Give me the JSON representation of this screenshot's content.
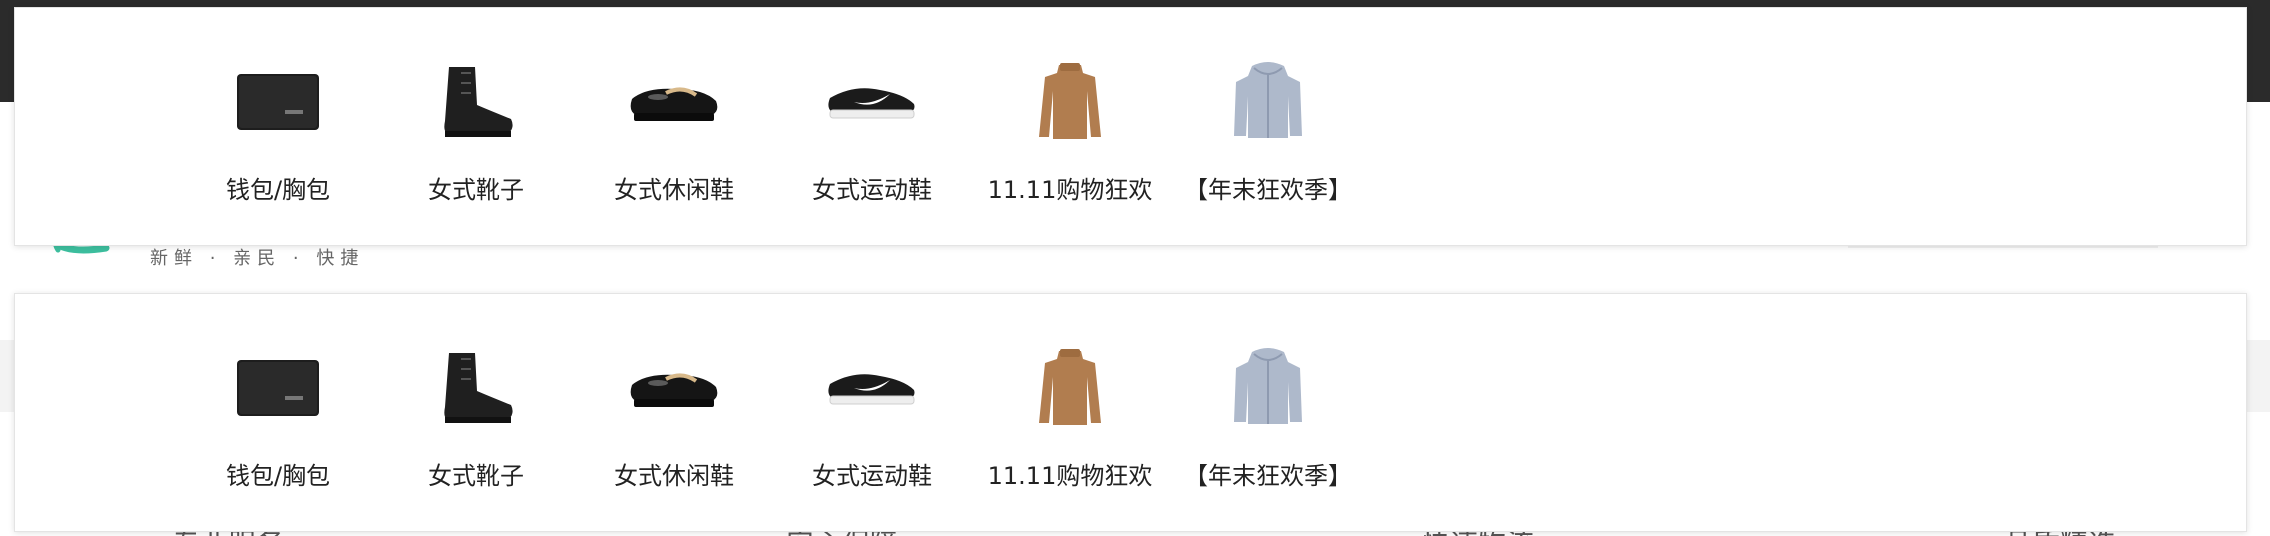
{
  "background": {
    "tagline": "新鲜 · 亲民 · 快捷",
    "bottom_texts": [
      "专业服务",
      "安心保障",
      "快速物流",
      "品质精选"
    ]
  },
  "panels": [
    {
      "categories": [
        {
          "label": "钱包/胸包",
          "icon": "wallet-icon"
        },
        {
          "label": "女式靴子",
          "icon": "boot-icon"
        },
        {
          "label": "女式休闲鞋",
          "icon": "loafer-icon"
        },
        {
          "label": "女式运动鞋",
          "icon": "sneaker-icon"
        },
        {
          "label": "11.11购物狂欢",
          "icon": "sweater-icon"
        },
        {
          "label": "【年末狂欢季】",
          "icon": "jacket-icon"
        }
      ]
    },
    {
      "categories": [
        {
          "label": "钱包/胸包",
          "icon": "wallet-icon"
        },
        {
          "label": "女式靴子",
          "icon": "boot-icon"
        },
        {
          "label": "女式休闲鞋",
          "icon": "loafer-icon"
        },
        {
          "label": "女式运动鞋",
          "icon": "sneaker-icon"
        },
        {
          "label": "11.11购物狂欢",
          "icon": "sweater-icon"
        },
        {
          "label": "【年末狂欢季】",
          "icon": "jacket-icon"
        }
      ]
    }
  ],
  "colors": {
    "accent_logo": "#3dbf9f",
    "text": "#222222",
    "panel_border": "#e4e4e4"
  }
}
